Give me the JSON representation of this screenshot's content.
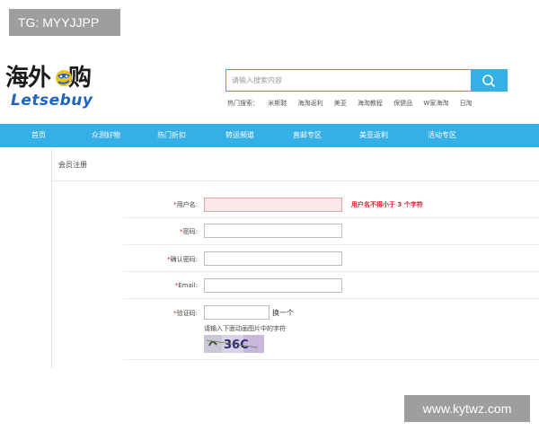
{
  "overlay": {
    "tg": "TG: MYYJJPP",
    "site": "www.kytwz.com"
  },
  "logo": {
    "cn": "海外购",
    "cn_part1": "海外",
    "cn_part2": "购",
    "en": "Letsebuy"
  },
  "search": {
    "placeholder": "请输入搜索内容",
    "button_icon": "search-icon"
  },
  "hot": {
    "label": "热门搜索：",
    "items": [
      "米斯鞋",
      "海淘返利",
      "美亚",
      "海淘教程",
      "保健品",
      "W家海淘",
      "日淘"
    ]
  },
  "nav": {
    "items": [
      "首页",
      "众测好物",
      "热门折扣",
      "转运频道",
      "直邮专区",
      "美亚返利",
      "活动专区"
    ]
  },
  "panel": {
    "title": "会员注册"
  },
  "form": {
    "username_label": "用户名:",
    "password_label": "密码:",
    "confirm_label": "确认密码:",
    "email_label": "Email:",
    "captcha_label": "验证码:",
    "required_mark": "*",
    "username_error": "用户名不得小于 3 个字符",
    "refresh_label": "换一个",
    "captcha_hint": "请输入下面动画图片中的字符",
    "captcha_text": "36C"
  },
  "colors": {
    "brand": "#35b0e6",
    "error": "#d8202a",
    "error_bg": "#fde8ea"
  }
}
